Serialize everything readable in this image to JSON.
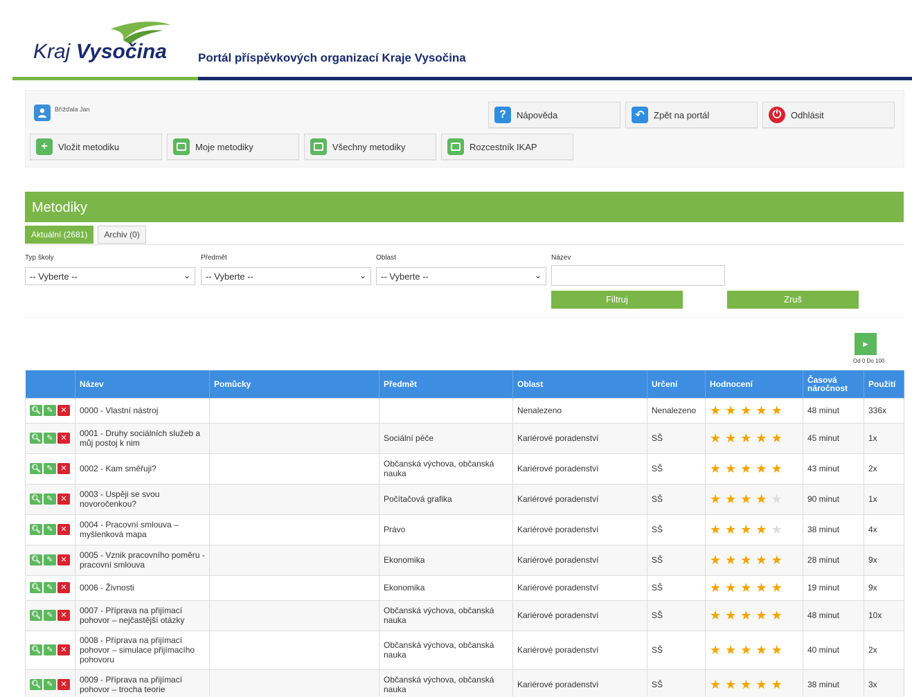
{
  "header": {
    "logo_kraj": "Kraj",
    "logo_vysocina": "Vysočina",
    "portal_title": "Portál příspěvkových organizací Kraje Vysočina"
  },
  "user": {
    "name": "Břížďala Jan"
  },
  "toolbar": {
    "help": "Nápověda",
    "back": "Zpět na portál",
    "logout": "Odhlásit",
    "insert": "Vložit metodiku",
    "my": "Moje metodiky",
    "all": "Všechny metodiky",
    "ikap": "Rozcestník IKAP"
  },
  "section": {
    "title": "Metodiky"
  },
  "tabs": {
    "current": "Aktuální (2681)",
    "archive": "Archiv (0)"
  },
  "filters": {
    "school_label": "Typ školy",
    "subject_label": "Předmět",
    "area_label": "Oblast",
    "name_label": "Název",
    "select_placeholder": "-- Vyberte --",
    "filter_btn": "Filtruj",
    "cancel_btn": "Zruš"
  },
  "pager": {
    "next": "►",
    "text": "Od 0 Do 100"
  },
  "table": {
    "headers": [
      "",
      "Název",
      "Pomůcky",
      "Předmět",
      "Oblast",
      "Určení",
      "Hodnocení",
      "Časová náročnost",
      "Použití"
    ],
    "rows": [
      {
        "name": "0000 - Vlastní nástroj",
        "tools": "",
        "subject": "",
        "area": "Nenalezeno",
        "target": "Nenalezeno",
        "rating": 5,
        "time": "48 minut",
        "usage": "336x"
      },
      {
        "name": "0001 - Druhy sociálních služeb a můj postoj k nim",
        "tools": "",
        "subject": "Sociální péče",
        "area": "Kariérové poradenství",
        "target": "SŠ",
        "rating": 5,
        "time": "45 minut",
        "usage": "1x"
      },
      {
        "name": "0002 - Kam směřuji?",
        "tools": "",
        "subject": "Občanská výchova, občanská nauka",
        "area": "Kariérové poradenství",
        "target": "SŠ",
        "rating": 5,
        "time": "43 minut",
        "usage": "2x"
      },
      {
        "name": "0003 - Uspěji se svou novoročenkou?",
        "tools": "",
        "subject": "Počítačová grafika",
        "area": "Kariérové poradenství",
        "target": "SŠ",
        "rating": 4,
        "time": "90 minut",
        "usage": "1x"
      },
      {
        "name": "0004 - Pracovní smlouva – myšlenková mapa",
        "tools": "",
        "subject": "Právo",
        "area": "Kariérové poradenství",
        "target": "SŠ",
        "rating": 4,
        "time": "38 minut",
        "usage": "4x"
      },
      {
        "name": "0005 - Vznik pracovního poměru - pracovní smlouva",
        "tools": "",
        "subject": "Ekonomika",
        "area": "Kariérové poradenství",
        "target": "SŠ",
        "rating": 5,
        "time": "28 minut",
        "usage": "9x"
      },
      {
        "name": "0006 - Živnosti",
        "tools": "",
        "subject": "Ekonomika",
        "area": "Kariérové poradenství",
        "target": "SŠ",
        "rating": 5,
        "time": "19 minut",
        "usage": "9x"
      },
      {
        "name": "0007 - Příprava na přijímací pohovor – nejčastější otázky",
        "tools": "",
        "subject": "Občanská výchova, občanská nauka",
        "area": "Kariérové poradenství",
        "target": "SŠ",
        "rating": 5,
        "time": "48 minut",
        "usage": "10x"
      },
      {
        "name": "0008 - Příprava na přijímací pohovor – simulace přijímacího pohovoru",
        "tools": "",
        "subject": "Občanská výchova, občanská nauka",
        "area": "Kariérové poradenství",
        "target": "SŠ",
        "rating": 5,
        "time": "40 minut",
        "usage": "2x"
      },
      {
        "name": "0009 - Příprava na přijímací pohovor – trocha teorie",
        "tools": "",
        "subject": "Občanská výchova, občanská nauka",
        "area": "Kariérové poradenství",
        "target": "SŠ",
        "rating": 5,
        "time": "38 minut",
        "usage": "3x"
      }
    ]
  },
  "colors": {
    "green": "#7ab648",
    "blue": "#3d8de0",
    "navy": "#1a2a6c",
    "red": "#d9232e",
    "star": "#f0a500"
  }
}
